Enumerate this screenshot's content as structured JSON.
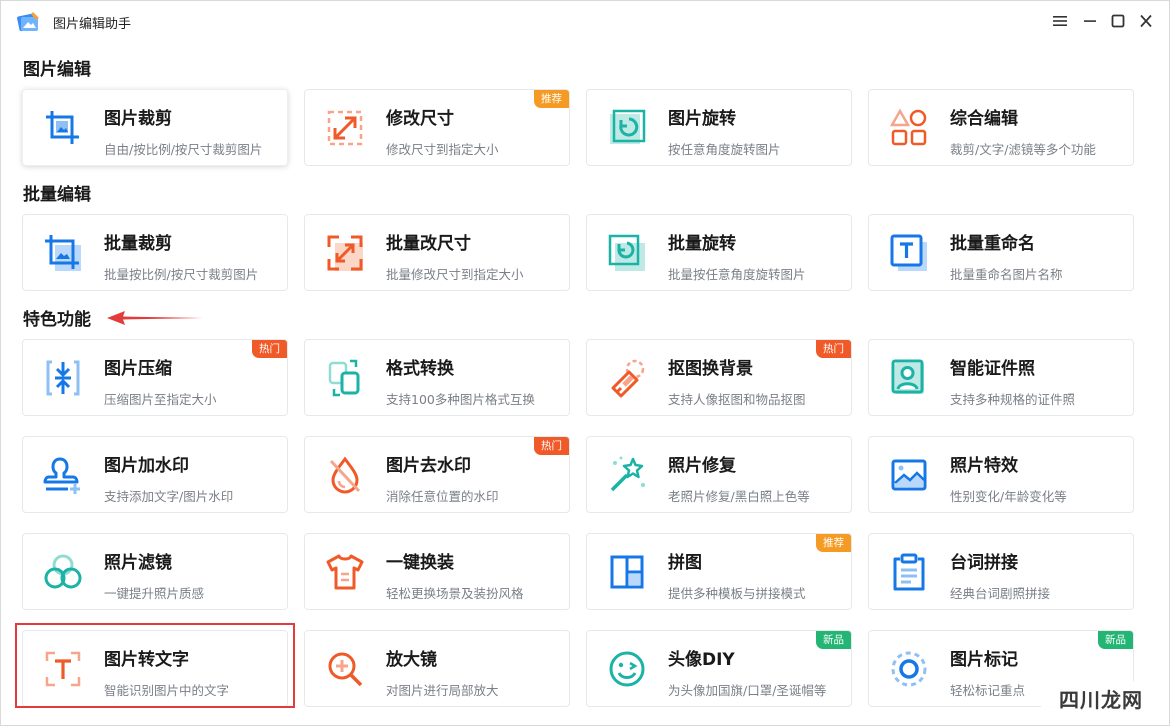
{
  "window": {
    "title": "图片编辑助手"
  },
  "sections": {
    "edit": "图片编辑",
    "batch": "批量编辑",
    "featured": "特色功能"
  },
  "cards": {
    "crop": {
      "title": "图片裁剪",
      "desc": "自由/按比例/按尺寸裁剪图片"
    },
    "resize": {
      "title": "修改尺寸",
      "desc": "修改尺寸到指定大小",
      "badge": "推荐"
    },
    "rotate": {
      "title": "图片旋转",
      "desc": "按任意角度旋转图片"
    },
    "combo": {
      "title": "综合编辑",
      "desc": "裁剪/文字/滤镜等多个功能"
    },
    "batch_crop": {
      "title": "批量裁剪",
      "desc": "批量按比例/按尺寸裁剪图片"
    },
    "batch_resize": {
      "title": "批量改尺寸",
      "desc": "批量修改尺寸到指定大小"
    },
    "batch_rotate": {
      "title": "批量旋转",
      "desc": "批量按任意角度旋转图片"
    },
    "batch_rename": {
      "title": "批量重命名",
      "desc": "批量重命名图片名称"
    },
    "compress": {
      "title": "图片压缩",
      "desc": "压缩图片至指定大小",
      "badge": "热门"
    },
    "convert": {
      "title": "格式转换",
      "desc": "支持100多种图片格式互换"
    },
    "cutout": {
      "title": "抠图换背景",
      "desc": "支持人像抠图和物品抠图",
      "badge": "热门"
    },
    "id_photo": {
      "title": "智能证件照",
      "desc": "支持多种规格的证件照"
    },
    "add_watermark": {
      "title": "图片加水印",
      "desc": "支持添加文字/图片水印"
    },
    "remove_watermark": {
      "title": "图片去水印",
      "desc": "消除任意位置的水印",
      "badge": "热门"
    },
    "repair": {
      "title": "照片修复",
      "desc": "老照片修复/黑白照上色等"
    },
    "effects": {
      "title": "照片特效",
      "desc": "性别变化/年龄变化等"
    },
    "filter": {
      "title": "照片滤镜",
      "desc": "一键提升照片质感"
    },
    "outfit": {
      "title": "一键换装",
      "desc": "轻松更换场景及装扮风格"
    },
    "collage": {
      "title": "拼图",
      "desc": "提供多种模板与拼接模式",
      "badge": "推荐"
    },
    "lines": {
      "title": "台词拼接",
      "desc": "经典台词剧照拼接"
    },
    "ocr": {
      "title": "图片转文字",
      "desc": "智能识别图片中的文字"
    },
    "magnifier": {
      "title": "放大镜",
      "desc": "对图片进行局部放大"
    },
    "avatar": {
      "title": "头像DIY",
      "desc": "为头像加国旗/口罩/圣诞帽等",
      "badge": "新品"
    },
    "mark": {
      "title": "图片标记",
      "desc": "轻松标记重点",
      "badge": "新品"
    }
  },
  "watermark": "四川龙网",
  "colors": {
    "blue": "#1677e6",
    "orange": "#f05a28",
    "teal": "#1bb3a6",
    "highlight": "#e23b3b"
  },
  "icons": {
    "window": [
      "app-logo-icon",
      "menu-icon",
      "minimize-icon",
      "maximize-icon",
      "close-icon"
    ]
  }
}
